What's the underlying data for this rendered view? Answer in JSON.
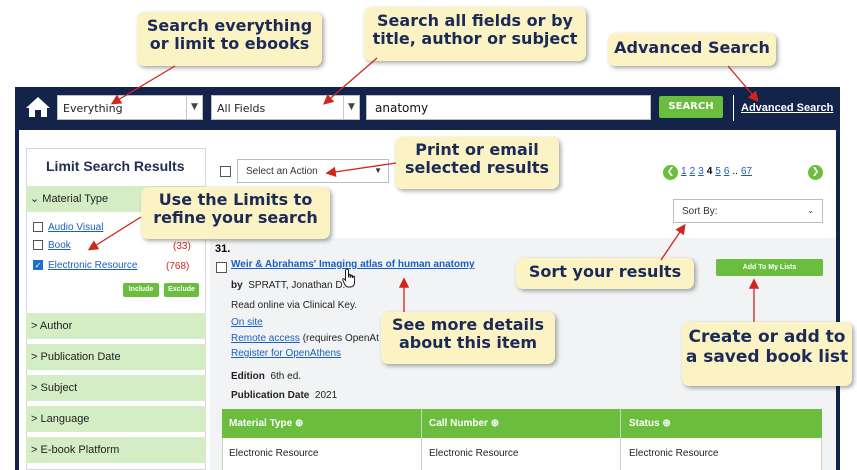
{
  "callouts": {
    "search_everything": [
      "Search everything",
      "or limit to ebooks"
    ],
    "search_fields": [
      "Search all fields or by",
      "title, author or subject"
    ],
    "advanced": "Advanced Search",
    "print_email": [
      "Print or email",
      "selected results"
    ],
    "use_limits": [
      "Use the Limits to",
      "refine your search"
    ],
    "sort": "Sort your results",
    "details": [
      "See more details",
      "about this item"
    ],
    "create_list": [
      "Create or add to",
      "a saved book list"
    ]
  },
  "search": {
    "scope": "Everything",
    "field": "All Fields",
    "query": "anatomy",
    "button": "SEARCH",
    "advanced_link": "Advanced Search"
  },
  "sidebar": {
    "title": "Limit Search Results",
    "material_type": "Material Type",
    "items": [
      {
        "label": "Audio Visual",
        "count": "",
        "checked": false
      },
      {
        "label": "Book",
        "count": "(33)",
        "checked": false
      },
      {
        "label": "Electronic Resource",
        "count": "(768)",
        "checked": true
      }
    ],
    "include": "Include",
    "exclude": "Exclude",
    "facets": [
      "Author",
      "Publication Date",
      "Subject",
      "Language",
      "E-book Platform"
    ]
  },
  "toolbar": {
    "action": "Select an Action",
    "sort_by": "Sort By:",
    "pages": [
      "1",
      "2",
      "3",
      "4",
      "5",
      "6",
      "..",
      "67"
    ],
    "current_page": "4"
  },
  "record": {
    "number": "31.",
    "title": "Weir & Abrahams' Imaging atlas of human anatomy",
    "by_label": "by",
    "author": "SPRATT, Jonathan D.",
    "note": "Read online via Clinical Key.",
    "on_site": "On site",
    "remote": "Remote access",
    "remote_suffix": "(requires OpenAt",
    "register": "Register for OpenAthens",
    "edition_label": "Edition",
    "edition": "6th ed.",
    "pubdate_label": "Publication Date",
    "pubdate": "2021",
    "add_list": "Add To My Lists"
  },
  "table": {
    "headers": [
      "Material Type",
      "Call Number",
      "Status"
    ],
    "row": [
      "Electronic Resource",
      "Electronic Resource",
      "Electronic Resource"
    ]
  },
  "colors": {
    "navy": "#14234a",
    "green": "#6bbd3e",
    "callout": "#fbf3c3",
    "link": "#1a5fc2"
  }
}
